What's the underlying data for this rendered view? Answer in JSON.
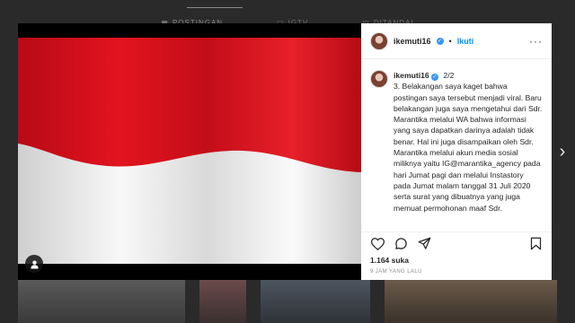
{
  "profile_tabs": [
    {
      "label": "POSTINGAN",
      "icon": "grid-icon",
      "active": true
    },
    {
      "label": "IGTV",
      "icon": "igtv-icon",
      "active": false
    },
    {
      "label": "DITANDAI",
      "icon": "tagged-icon",
      "active": false
    }
  ],
  "post": {
    "header": {
      "username": "ikemuti16",
      "separator": "•",
      "follow_label": "Ikuti",
      "more_icon": "more-options-icon"
    },
    "caption": {
      "username": "ikemuti16",
      "page_indicator": "2/2",
      "text": "3. Belakangan saya kaget bahwa postingan saya tersebut menjadi viral. Baru belakangan juga saya mengetahui dari Sdr. Marantika melalui WA bahwa informasi yang saya dapatkan darinya adalah tidak benar. Hal ini juga disampaikan oleh Sdr. Marantika melalui akun media sosial miliknya yaitu IG@marantika_agency pada hari Jumat pagi dan melalui Instastory pada Jumat malam tanggal 31 Juli 2020 serta surat yang dibuatnya yang juga memuat permohonan maaf Sdr."
    },
    "likes": "1.164 suka",
    "timestamp": "9 JAM YANG LALU"
  },
  "colors": {
    "flag_red": "#d8101e",
    "flag_white": "#f2f2f2",
    "verified_blue": "#3897f0",
    "follow_blue": "#0095f6"
  }
}
